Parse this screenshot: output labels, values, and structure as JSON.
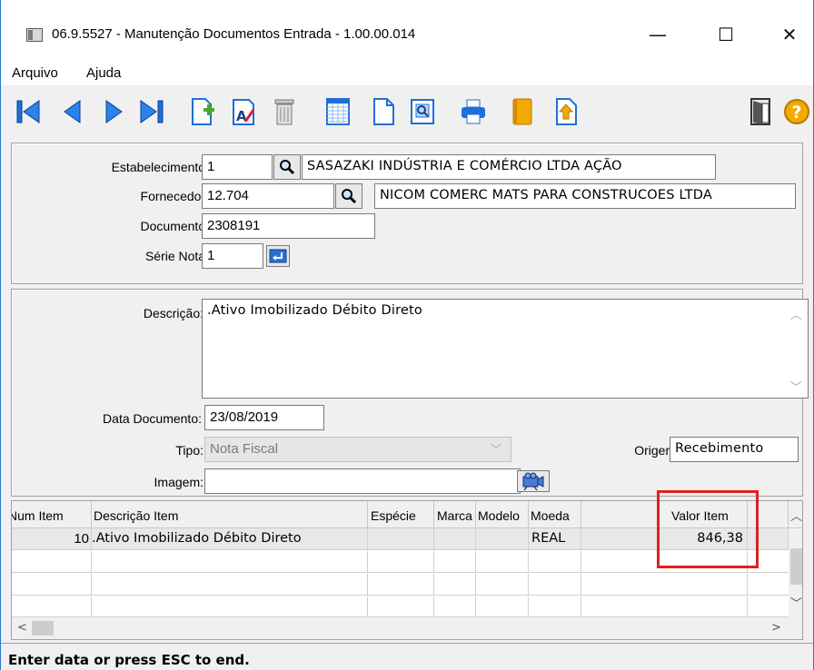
{
  "window": {
    "title": "06.9.5527 - Manutenção Documentos Entrada - 1.00.00.014",
    "minimize_glyph": "—",
    "maximize_glyph": "☐",
    "close_glyph": "✕"
  },
  "menu": {
    "items": [
      "Arquivo",
      "Ajuda"
    ]
  },
  "toolbar": {
    "icons": [
      "first-record-icon",
      "previous-record-icon",
      "next-record-icon",
      "last-record-icon",
      "add-document-icon",
      "edit-document-icon",
      "delete-icon",
      "grid-view-icon",
      "new-page-icon",
      "preview-icon",
      "print-icon",
      "book-icon",
      "export-icon",
      "exit-door-icon",
      "help-icon"
    ],
    "help_label": "?"
  },
  "header": {
    "estabelecimento_label": "Estabelecimento:",
    "estabelecimento_value": "1",
    "estabelecimento_name": "SASAZAKI INDÚSTRIA E COMÉRCIO LTDA AÇÃO",
    "fornecedor_label": "Fornecedor:",
    "fornecedor_value": "12.704",
    "fornecedor_name": "NICOM COMERC MATS PARA CONSTRUCOES LTDA",
    "documento_label": "Documento:",
    "documento_value": "2308191",
    "serie_label": "Série Nota:",
    "serie_value": "1"
  },
  "details": {
    "descricao_label": "Descrição:",
    "descricao_value": ".Ativo Imobilizado Débito Direto",
    "data_label": "Data Documento:",
    "data_value": "23/08/2019",
    "tipo_label": "Tipo:",
    "tipo_value": "Nota Fiscal",
    "origem_label": "Origem:",
    "origem_value": "Recebimento",
    "imagem_label": "Imagem:",
    "imagem_value": ""
  },
  "grid": {
    "columns": [
      "Num Item",
      "Descrição Item",
      "Espécie",
      "Marca",
      "Modelo",
      "Moeda",
      "Valor Item"
    ],
    "rows": [
      {
        "num": "10",
        "descricao": ".Ativo Imobilizado Débito Direto",
        "especie": "",
        "marca": "",
        "modelo": "",
        "moeda": "REAL",
        "valor": "846,38"
      }
    ]
  },
  "status": {
    "text": "Enter data or press ESC to end."
  },
  "colors": {
    "highlight": "#e02020",
    "window_border": "#2b78d4"
  }
}
